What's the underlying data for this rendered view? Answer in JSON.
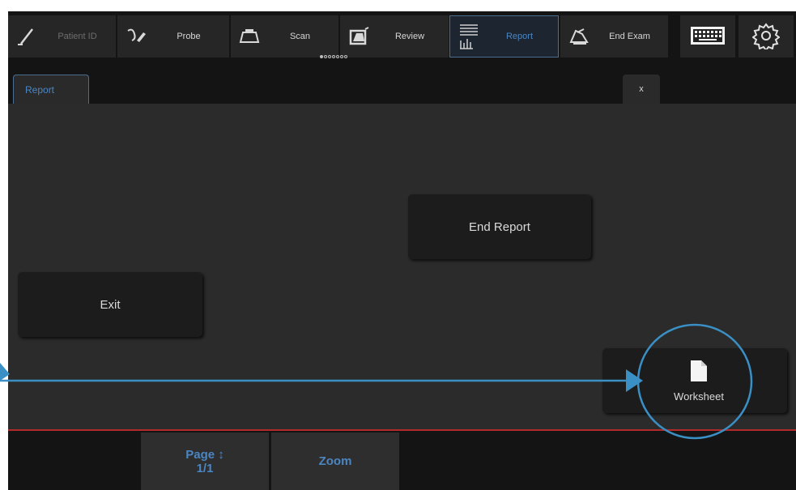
{
  "toolbar": {
    "items": [
      {
        "label": "Patient ID",
        "icon": "pen-icon"
      },
      {
        "label": "Probe",
        "icon": "probe-icon"
      },
      {
        "label": "Scan",
        "icon": "scan-icon"
      },
      {
        "label": "Review",
        "icon": "review-icon"
      },
      {
        "label": "Report",
        "icon": "report-icon"
      },
      {
        "label": "End Exam",
        "icon": "end-exam-icon"
      }
    ],
    "keyboard_icon": "keyboard-icon",
    "settings_icon": "gear-icon",
    "page_dots": {
      "total": 7,
      "active": 1
    }
  },
  "tabs": {
    "report_label": "Report",
    "close_label": "x"
  },
  "main": {
    "end_report_label": "End Report",
    "exit_label": "Exit",
    "worksheet_label": "Worksheet"
  },
  "bottom": {
    "page_label": "Page ↕",
    "page_value": "1/1",
    "zoom_label": "Zoom"
  },
  "colors": {
    "accent": "#4b86c2",
    "annotation": "#3a8fc4",
    "red_divider": "#b22a2a"
  }
}
